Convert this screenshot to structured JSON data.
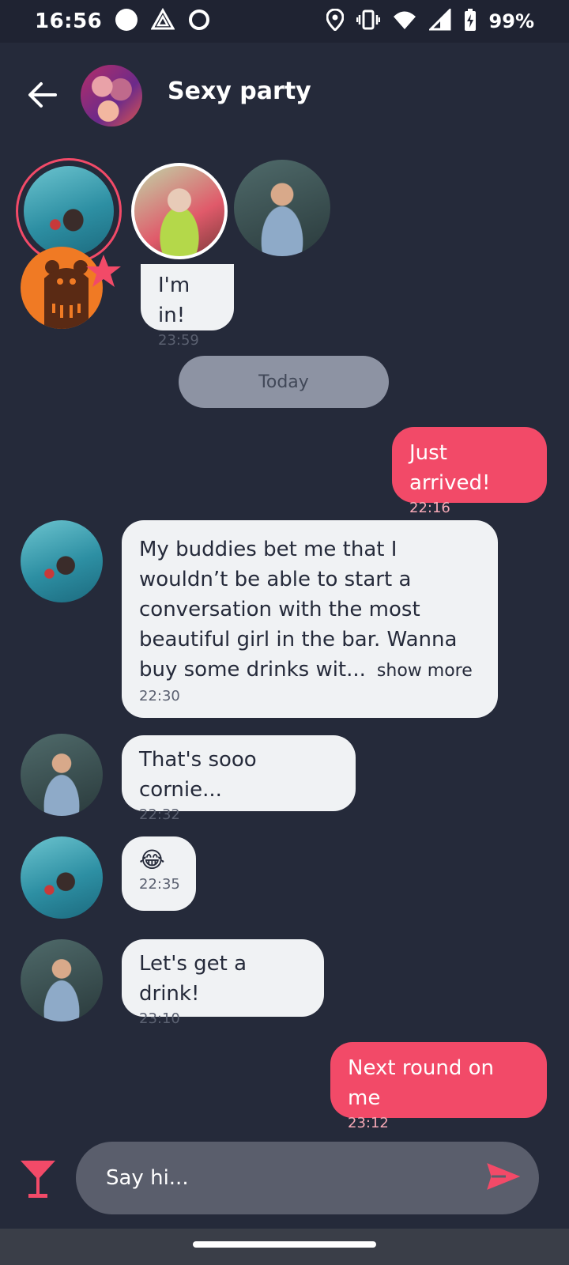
{
  "status_bar": {
    "time": "16:56",
    "battery": "99%",
    "icons": [
      "circle-icon",
      "triangle-warning-icon",
      "data-saver-icon",
      "location-icon",
      "vibrate-icon",
      "wifi-icon",
      "signal-icon",
      "battery-charging-icon"
    ]
  },
  "header": {
    "title": "Sexy party",
    "back_icon": "arrow-left-icon"
  },
  "participants": [
    "waterman",
    "queen",
    "man-blue-shirt"
  ],
  "messages": [
    {
      "direction": "in",
      "avatar": "bear",
      "text": "I'm in!",
      "time": "23:59"
    },
    {
      "direction": "divider",
      "text": "Today"
    },
    {
      "direction": "out",
      "text": "Just arrived!",
      "time": "22:16"
    },
    {
      "direction": "in",
      "avatar": "waterman",
      "text_lines": [
        "My buddies bet me that I",
        "wouldn’t be able to start a",
        "conversation with the most",
        "beautiful girl in the bar. Wanna",
        "buy some drinks wit..."
      ],
      "show_more": "show more",
      "time": "22:30"
    },
    {
      "direction": "in",
      "avatar": "man-blue-shirt",
      "text": "That's sooo cornie...",
      "time": "22:32"
    },
    {
      "direction": "in",
      "avatar": "waterman",
      "text": "😂",
      "time": "22:35"
    },
    {
      "direction": "in",
      "avatar": "man-blue-shirt",
      "text": "Let's get a drink!",
      "time": "23:10"
    },
    {
      "direction": "out",
      "text": "Next round on me",
      "time": "23:12"
    }
  ],
  "composer": {
    "placeholder": "Say hi...",
    "left_icon": "cocktail-icon",
    "send_icon": "send-icon"
  },
  "colors": {
    "background": "#252a3a",
    "accent": "#f24a68",
    "incoming_bubble": "#f0f2f4",
    "divider": "#8d93a3"
  }
}
